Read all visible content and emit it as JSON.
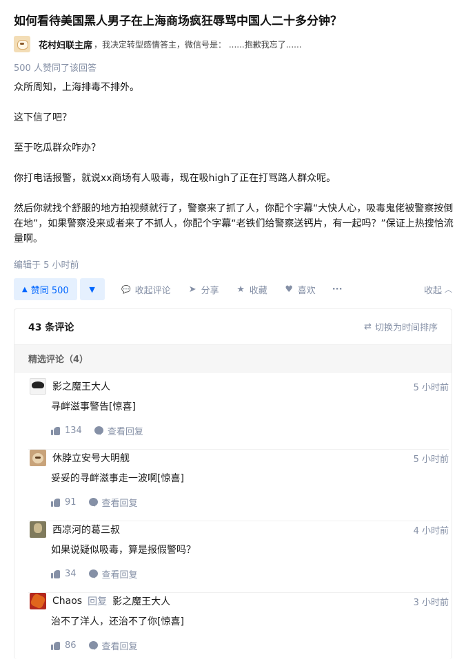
{
  "question": {
    "title": "如何看待美国黑人男子在上海商场疯狂辱骂中国人二十多分钟？"
  },
  "author": {
    "name": "花村妇联主席",
    "bio": "，我决定转型感情答主，微信号是：  ......抱歉我忘了......"
  },
  "answer": {
    "vote_summary": "500 人赞同了该回答",
    "paragraphs": [
      "众所周知，上海排毒不排外。",
      "这下信了吧？",
      "至于吃瓜群众咋办？",
      "你打电话报警，就说xx商场有人吸毒，现在吸high了正在打骂路人群众呢。",
      "然后你就找个舒服的地方拍视频就行了，警察来了抓了人，你配个字幕“大快人心，吸毒鬼佬被警察按倒在地”，如果警察没来或者来了不抓人，你配个字幕“老铁们给警察送钙片，有一起吗？”保证上热搜恰流量啊。"
    ],
    "edit_time": "编辑于 5 小时前"
  },
  "actions": {
    "upvote_label": "赞同 500",
    "upvote_icon": "▲",
    "downvote_icon": "▼",
    "collapse_comments": "收起评论",
    "share": "分享",
    "favorite": "收藏",
    "like": "喜欢",
    "more": "···",
    "collapse": "收起",
    "collapse_arrow": "︿"
  },
  "comments": {
    "count_label": "43 条评论",
    "sort_label": "切换为时间排序",
    "sort_icon": "⇄",
    "section_label": "精选评论（4）",
    "view_replies_label": "查看回复",
    "items": [
      {
        "name": "影之魔王大人",
        "time": "5 小时前",
        "text": "寻衅滋事警告[惊喜]",
        "likes": "134"
      },
      {
        "name": "休脖立安号大明舰",
        "time": "5 小时前",
        "text": "妥妥的寻衅滋事走一波啊[惊喜]",
        "likes": "91"
      },
      {
        "name": "西凉河的葛三叔",
        "time": "4 小时前",
        "text": "如果说疑似吸毒，算是报假警吗？",
        "likes": "34"
      },
      {
        "name": "Chaos",
        "reply_word": "回复",
        "reply_to": "影之魔王大人",
        "time": "3 小时前",
        "text": "治不了洋人，还治不了你[惊喜]",
        "likes": "86"
      }
    ]
  },
  "icons": {
    "comment": "💬",
    "share": "➤",
    "star": "★",
    "heart": "♥"
  },
  "colors": {
    "accent": "#0066ff",
    "vote_bg": "#e5f0fe",
    "meta": "#8590a6"
  }
}
